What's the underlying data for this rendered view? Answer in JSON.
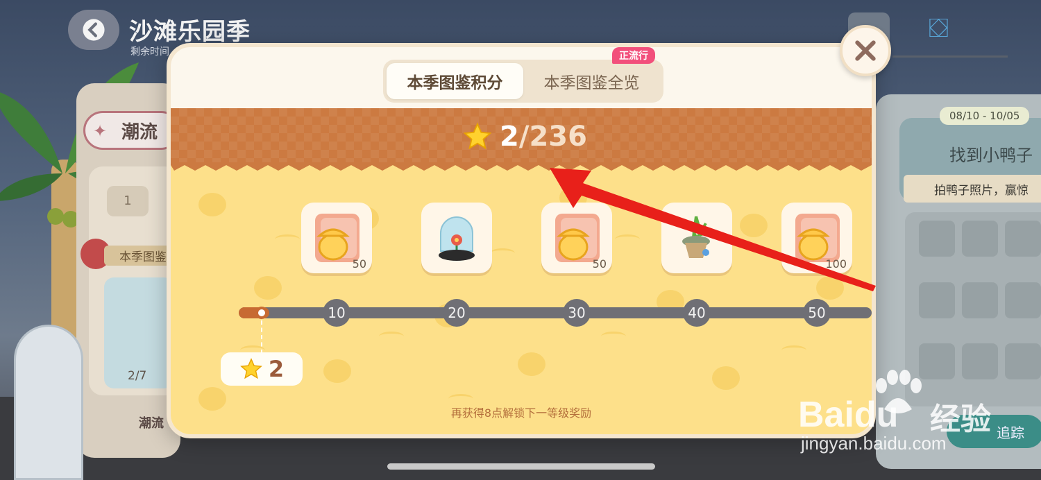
{
  "background": {
    "title": "沙滩乐园季",
    "subtitle": "剩余时间",
    "chip_label": "潮流",
    "counter": "1",
    "season_label": "本季图鉴",
    "fraction": "2/7",
    "hot_label": "潮流",
    "right_panel": {
      "date_range": "08/10 - 10/05",
      "title": "找到小鸭子",
      "subtitle": "拍鸭子照片，赢惊",
      "track_button": "追踪"
    }
  },
  "modal": {
    "tabs": [
      {
        "label": "本季图鉴积分",
        "active": true
      },
      {
        "label": "本季图鉴全览",
        "active": false
      }
    ],
    "tab_badge": "正流行",
    "score": {
      "current": "2",
      "total": "/236"
    },
    "rewards": [
      {
        "icon": "acorn-card-icon",
        "amount": "50"
      },
      {
        "icon": "glass-dome-flower-icon",
        "amount": ""
      },
      {
        "icon": "acorn-card-icon",
        "amount": "50"
      },
      {
        "icon": "potted-plant-icon",
        "amount": ""
      },
      {
        "icon": "acorn-card-icon",
        "amount": "100"
      }
    ],
    "milestones": [
      "10",
      "20",
      "30",
      "40",
      "50"
    ],
    "progress": {
      "current": 2,
      "max_visible": 50
    },
    "current_badge": "2",
    "hint": "再获得8点解锁下一等级奖励"
  },
  "watermark": {
    "logo": "Baidu",
    "cn": "经验",
    "url": "jingyan.baidu.com"
  },
  "colors": {
    "accent_orange": "#cc7a41",
    "field_yellow": "#fde08a",
    "badge_pink": "#f24f7b",
    "arrow_red": "#e8201a"
  }
}
